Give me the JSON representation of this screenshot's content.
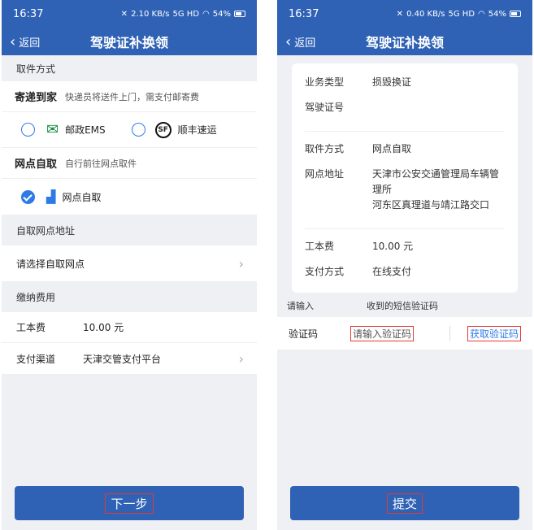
{
  "status": {
    "time": "16:37",
    "battery": "54%",
    "left_speed": "2.10",
    "right_speed": "0.40",
    "speed_unit": "KB/s",
    "sim": "5G HD"
  },
  "nav": {
    "back": "返回",
    "title": "驾驶证补换领"
  },
  "left": {
    "section_pickup": "取件方式",
    "delivery": {
      "title": "寄递到家",
      "desc": "快递员将送件上门，需支付邮寄费",
      "ems": "邮政EMS",
      "sf": "顺丰速运"
    },
    "self_pickup": {
      "title": "网点自取",
      "desc": "自行前往网点取件",
      "option": "网点自取"
    },
    "section_address": "自取网点地址",
    "select_point": "请选择自取网点",
    "section_fee": "缴纳费用",
    "fee_label": "工本费",
    "fee_value": "10.00 元",
    "pay_channel_label": "支付渠道",
    "pay_channel_value": "天津交管支付平台",
    "next_button": "下一步"
  },
  "right": {
    "business_type_label": "业务类型",
    "business_type_value": "损毁换证",
    "license_no_label": "驾驶证号",
    "pickup_label": "取件方式",
    "pickup_value": "网点自取",
    "address_label": "网点地址",
    "address_line1": "天津市公安交通管理局车辆管",
    "address_line2": "理所",
    "address_line3": "河东区真理道与靖江路交口",
    "fee_label": "工本费",
    "fee_value": "10.00 元",
    "pay_label": "支付方式",
    "pay_value": "在线支付",
    "hint_left": "请输入",
    "hint_right": "收到的短信验证码",
    "code_label": "验证码",
    "code_placeholder": "请输入验证码",
    "get_code": "获取验证码",
    "submit_button": "提交"
  },
  "colors": {
    "primary": "#2f62b5",
    "accent": "#2f7be6",
    "highlight": "#e53935"
  }
}
